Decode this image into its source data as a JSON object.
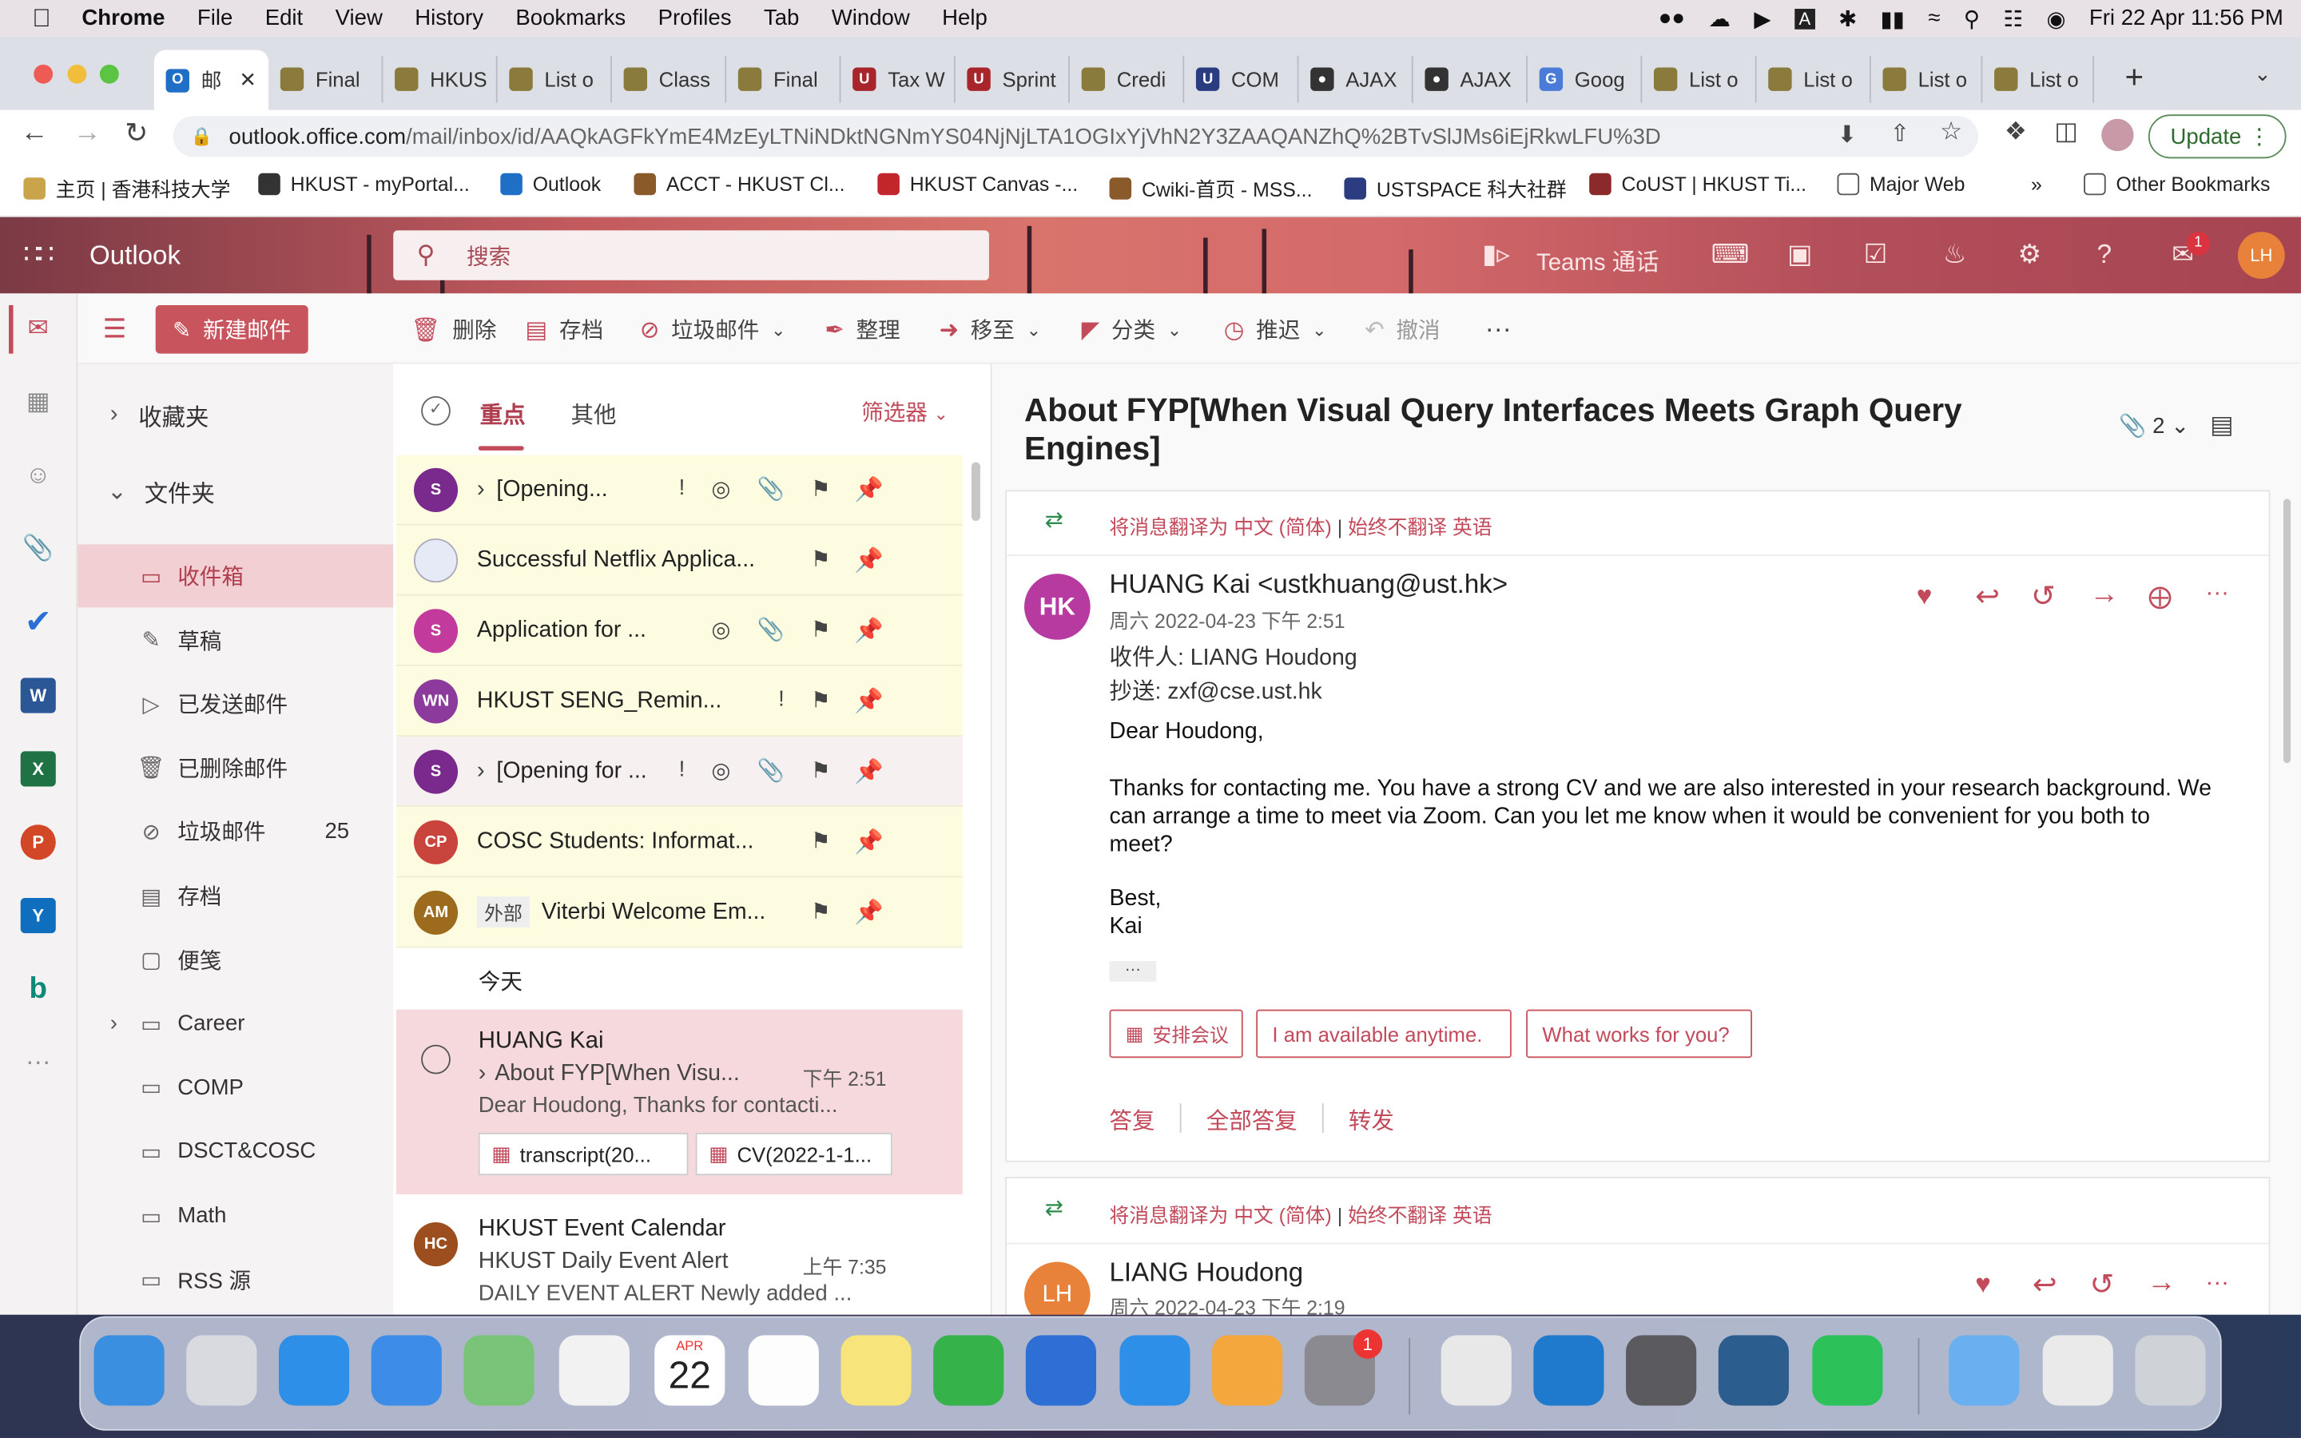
{
  "menubar": {
    "apple": "",
    "app": "Chrome",
    "items": [
      "File",
      "Edit",
      "View",
      "History",
      "Bookmarks",
      "Profiles",
      "Tab",
      "Window",
      "Help"
    ],
    "clock": "Fri 22 Apr  11:56 PM"
  },
  "tabs": [
    {
      "label": "邮",
      "icon": "outlook-icon"
    },
    {
      "label": "Final",
      "icon": "hkust-icon"
    },
    {
      "label": "HKUS",
      "icon": "hkust-icon"
    },
    {
      "label": "List o",
      "icon": "hkust-icon"
    },
    {
      "label": "Class",
      "icon": "hkust-icon"
    },
    {
      "label": "Final",
      "icon": "hkust-icon"
    },
    {
      "label": "Tax W",
      "icon": "usc-icon"
    },
    {
      "label": "Sprint",
      "icon": "usc-icon"
    },
    {
      "label": "Credi",
      "icon": "hkust-icon"
    },
    {
      "label": "COM",
      "icon": "u-icon"
    },
    {
      "label": "AJAX",
      "icon": "github-icon"
    },
    {
      "label": "AJAX",
      "icon": "github-icon"
    },
    {
      "label": "Goog",
      "icon": "google-icon"
    },
    {
      "label": "List o",
      "icon": "hkust-icon"
    },
    {
      "label": "List o",
      "icon": "hkust-icon"
    },
    {
      "label": "List o",
      "icon": "hkust-icon"
    },
    {
      "label": "List o",
      "icon": "hkust-icon"
    }
  ],
  "address": {
    "host": "outlook.office.com",
    "path": "/mail/inbox/id/AAQkAGFkYmE4MzEyLTNiNDktNGNmYS04NjNjLTA1OGIxYjVhN2Y3ZAAQANZhQ%2BTvSlJMs6iEjRkwLFU%3D",
    "update": "Update"
  },
  "bookmarks": [
    "主页 | 香港科技大学",
    "HKUST - myPortal...",
    "Outlook",
    "ACCT - HKUST Cl...",
    "HKUST Canvas -...",
    "Cwiki-首页 - MSS...",
    "USTSPACE 科大社群",
    "CoUST | HKUST Ti...",
    "Major Web",
    "»",
    "Other Bookmarks"
  ],
  "owa": {
    "brand": "Outlook",
    "search_placeholder": "搜索",
    "teams": "Teams 通话",
    "avatar": "LH",
    "badge": "1"
  },
  "toolbar": {
    "new_mail": "新建邮件",
    "delete": "删除",
    "archive": "存档",
    "junk": "垃圾邮件",
    "sweep": "整理",
    "move": "移至",
    "categorize": "分类",
    "snooze": "推迟",
    "undo": "撤消",
    "more": "···"
  },
  "folders": {
    "favorites": "收藏夹",
    "folders": "文件夹",
    "items": [
      {
        "label": "收件箱",
        "icon": "inbox-icon",
        "count": ""
      },
      {
        "label": "草稿",
        "icon": "pencil-icon",
        "count": ""
      },
      {
        "label": "已发送邮件",
        "icon": "send-icon",
        "count": ""
      },
      {
        "label": "已删除邮件",
        "icon": "trash-icon",
        "count": ""
      },
      {
        "label": "垃圾邮件",
        "icon": "block-icon",
        "count": "25"
      },
      {
        "label": "存档",
        "icon": "archive-icon",
        "count": ""
      },
      {
        "label": "便笺",
        "icon": "note-icon",
        "count": ""
      },
      {
        "label": "Career",
        "icon": "folder-icon",
        "count": ""
      },
      {
        "label": "COMP",
        "icon": "folder-icon",
        "count": ""
      },
      {
        "label": "DSCT&COSC",
        "icon": "folder-icon",
        "count": ""
      },
      {
        "label": "Math",
        "icon": "folder-icon",
        "count": ""
      },
      {
        "label": "RSS 源",
        "icon": "folder-icon",
        "count": ""
      }
    ]
  },
  "list": {
    "focused": "重点",
    "other": "其他",
    "filter": "筛选器",
    "today": "今天",
    "pinned": [
      {
        "avatar": "S",
        "color": "#7a2a8c",
        "subject": "[Opening...",
        "chev": "›"
      },
      {
        "avatar": "",
        "color": "#6b7fc0",
        "subject": "Successful Netflix Applica..."
      },
      {
        "avatar": "S",
        "color": "#c23b9c",
        "subject": "Application for ..."
      },
      {
        "avatar": "WN",
        "color": "#8c3b9c",
        "subject": "HKUST SENG_Remin..."
      },
      {
        "avatar": "S",
        "color": "#7a2a8c",
        "subject": "[Opening for ...",
        "chev": "›"
      },
      {
        "avatar": "CP",
        "color": "#c9443c",
        "subject": "COSC Students: Informat..."
      },
      {
        "avatar": "AM",
        "color": "#9c6b1e",
        "subject": "Viterbi Welcome Em...",
        "tag": "外部"
      }
    ],
    "selected": {
      "sender": "HUANG Kai",
      "subject": "About FYP[When Visu...",
      "time": "下午 2:51",
      "preview": "Dear Houdong, Thanks for contacti...",
      "attachments": [
        "transcript(20...",
        "CV(2022-1-1..."
      ]
    },
    "next": {
      "avatar": "HC",
      "sender": "HKUST Event Calendar",
      "subject": "HKUST Daily Event Alert",
      "time": "上午 7:35",
      "preview": "DAILY EVENT ALERT Newly added ..."
    }
  },
  "reading": {
    "title": "About FYP[When Visual Query Interfaces Meets Graph Query Engines]",
    "attach_count": "2",
    "translate": "将消息翻译为 中文 (简体)",
    "sep": "|",
    "never": "始终不翻译 英语",
    "msg1": {
      "avatar": "HK",
      "from": "HUANG Kai <ustkhuang@ust.hk>",
      "date": "周六 2022-04-23 下午 2:51",
      "to": "收件人: LIANG Houdong",
      "cc": "抄送: zxf@cse.ust.hk",
      "greeting": "Dear Houdong,",
      "body": "Thanks for contacting me. You have a strong CV and we are also interested in your research background. We can arrange a time to meet via Zoom. Can you let me know when it would  be convenient for you both to meet?",
      "sign1": "Best,",
      "sign2": "Kai",
      "ellipsis": "···",
      "suggest": [
        "安排会议",
        "I am available anytime.",
        "What works for you?"
      ],
      "reply": "答复",
      "reply_all": "全部答复",
      "forward": "转发"
    },
    "msg2": {
      "avatar": "LH",
      "from": "LIANG Houdong",
      "date": "周六 2022-04-23 下午 2:19"
    }
  },
  "dock": {
    "calendar_month": "APR",
    "calendar_day": "22",
    "settings_badge": "1"
  }
}
